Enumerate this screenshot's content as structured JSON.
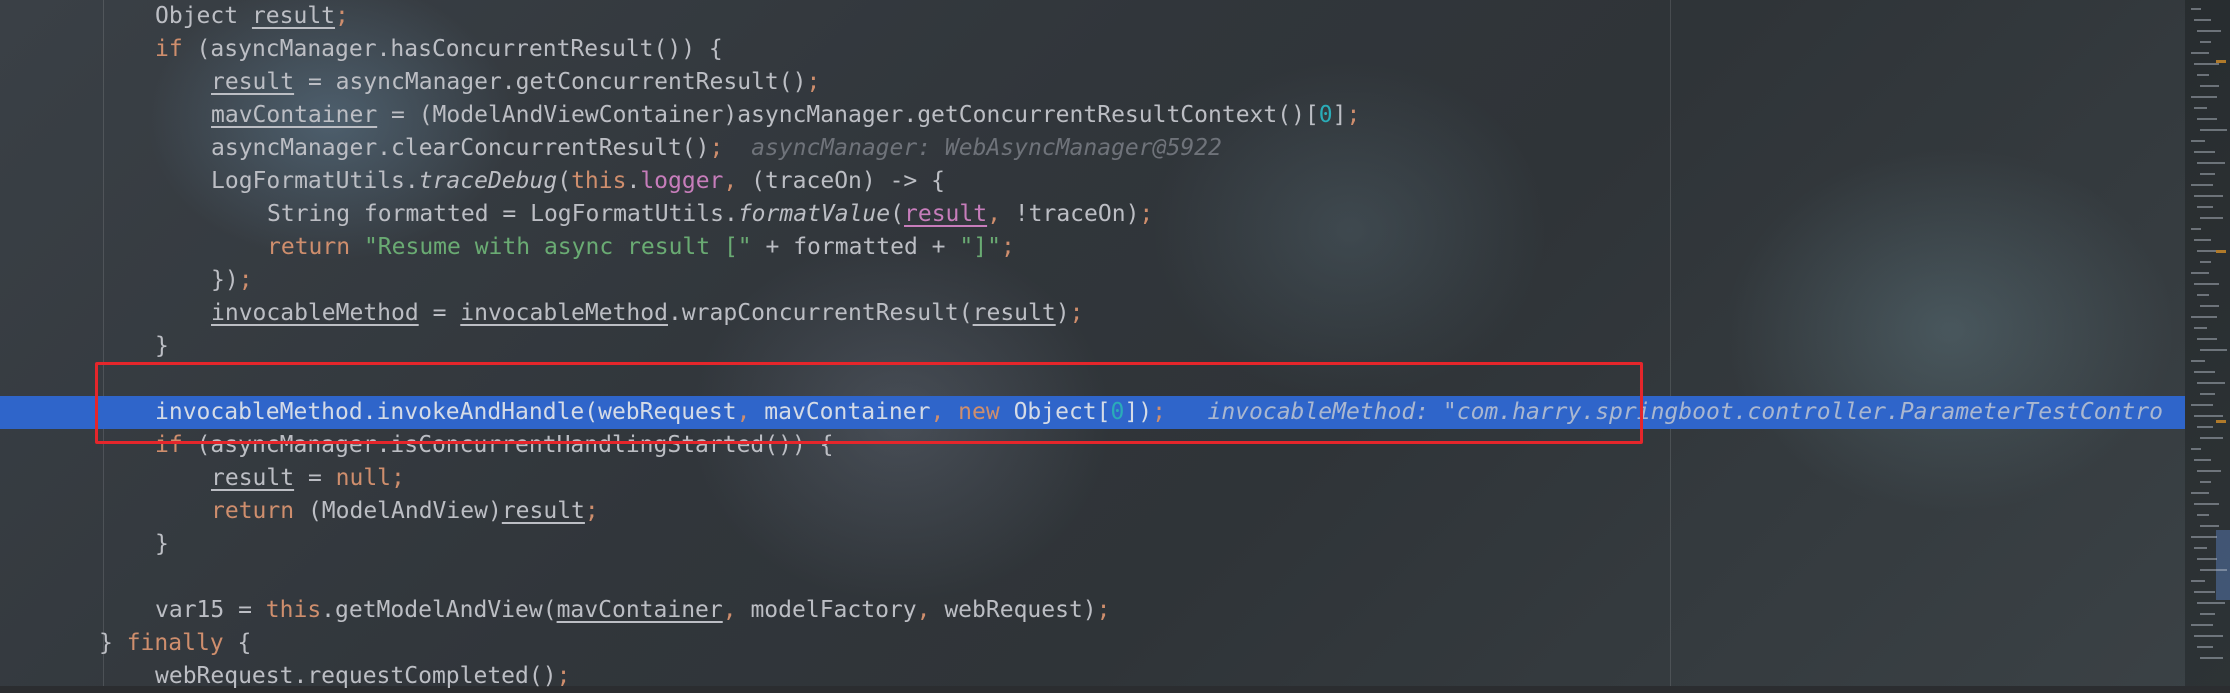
{
  "editor": {
    "lines": [
      {
        "segments": [
          [
            "Object ",
            ""
          ],
          [
            "result",
            "ul"
          ],
          [
            ";",
            "kw"
          ]
        ]
      },
      {
        "segments": [
          [
            "if",
            "kw"
          ],
          [
            " (asyncManager.hasConcurrentResult()) {",
            ""
          ]
        ]
      },
      {
        "segments": [
          [
            "result",
            "ul"
          ],
          [
            " = asyncManager.getConcurrentResult()",
            ""
          ],
          [
            ";",
            "kw"
          ]
        ]
      },
      {
        "segments": [
          [
            "mavContainer",
            "ul"
          ],
          [
            " = (ModelAndViewContainer)asyncManager.getConcurrentResultContext()[",
            ""
          ],
          [
            "0",
            "num"
          ],
          [
            "]",
            ""
          ],
          [
            ";",
            "kw"
          ]
        ]
      },
      {
        "segments": [
          [
            "asyncManager.clearConcurrentResult()",
            ""
          ],
          [
            ";",
            "kw"
          ],
          [
            "  ",
            ""
          ],
          [
            "asyncManager: WebAsyncManager@5922",
            "hint"
          ]
        ]
      },
      {
        "segments": [
          [
            "LogFormatUtils.",
            ""
          ],
          [
            "traceDebug",
            "it"
          ],
          [
            "(",
            ""
          ],
          [
            "this",
            "kw"
          ],
          [
            ".",
            ""
          ],
          [
            "logger",
            "fld"
          ],
          [
            ", ",
            "kw"
          ],
          [
            "(traceOn) -> {",
            ""
          ]
        ]
      },
      {
        "segments": [
          [
            "String formatted = LogFormatUtils.",
            ""
          ],
          [
            "formatValue",
            "it"
          ],
          [
            "(",
            ""
          ],
          [
            "result",
            "fld ul"
          ],
          [
            ", ",
            "kw"
          ],
          [
            "!traceOn)",
            ""
          ],
          [
            ";",
            "kw"
          ]
        ]
      },
      {
        "segments": [
          [
            "return ",
            "kw"
          ],
          [
            "\"Resume with async result [\"",
            "str"
          ],
          [
            " + formatted + ",
            ""
          ],
          [
            "\"]\"",
            "str"
          ],
          [
            ";",
            "kw"
          ]
        ]
      },
      {
        "segments": [
          [
            "})",
            ""
          ],
          [
            ";",
            "kw"
          ]
        ]
      },
      {
        "segments": [
          [
            "invocableMethod",
            "ul"
          ],
          [
            " = ",
            ""
          ],
          [
            "invocableMethod",
            "ul"
          ],
          [
            ".wrapConcurrentResult(",
            ""
          ],
          [
            "result",
            "ul"
          ],
          [
            ")",
            ""
          ],
          [
            ";",
            "kw"
          ]
        ]
      },
      {
        "segments": [
          [
            "}",
            ""
          ]
        ]
      },
      {
        "segments": []
      },
      {
        "segments": [
          [
            "invocableMethod.invokeAndHandle(webRequest",
            ""
          ],
          [
            ", ",
            "kw"
          ],
          [
            "mavContainer",
            ""
          ],
          [
            ", ",
            "kw"
          ],
          [
            "new ",
            "kw"
          ],
          [
            "Object[",
            ""
          ],
          [
            "0",
            "num"
          ],
          [
            "])",
            ""
          ],
          [
            ";",
            "kw"
          ],
          [
            "   ",
            ""
          ],
          [
            "invocableMethod: \"com.harry.springboot.controller.ParameterTestContro",
            "hint"
          ]
        ]
      },
      {
        "segments": [
          [
            "if",
            "kw"
          ],
          [
            " (asyncManager.isConcurrentHandlingStarted()) {",
            ""
          ]
        ]
      },
      {
        "segments": [
          [
            "result",
            "ul"
          ],
          [
            " = ",
            ""
          ],
          [
            "null",
            "kw"
          ],
          [
            ";",
            "kw"
          ]
        ]
      },
      {
        "segments": [
          [
            "return ",
            "kw"
          ],
          [
            "(ModelAndView)",
            ""
          ],
          [
            "result",
            "ul"
          ],
          [
            ";",
            "kw"
          ]
        ]
      },
      {
        "segments": [
          [
            "}",
            ""
          ]
        ]
      },
      {
        "segments": []
      },
      {
        "segments": [
          [
            "var15 = ",
            ""
          ],
          [
            "this",
            "kw"
          ],
          [
            ".getModelAndView(",
            ""
          ],
          [
            "mavContainer",
            "ul"
          ],
          [
            ", ",
            "kw"
          ],
          [
            "modelFactory",
            ""
          ],
          [
            ", ",
            "kw"
          ],
          [
            "webRequest)",
            ""
          ],
          [
            ";",
            "kw"
          ]
        ]
      },
      {
        "segments": [
          [
            "} ",
            ""
          ],
          [
            "finally ",
            "kw"
          ],
          [
            "{",
            ""
          ]
        ]
      },
      {
        "segments": [
          [
            "webRequest.requestCompleted()",
            ""
          ],
          [
            ";",
            "kw"
          ]
        ]
      }
    ]
  },
  "colors": {
    "current_line": "#2f65ca",
    "highlight_box": "#e5262b",
    "keyword": "#cf8e6d",
    "field": "#c77dbb",
    "number": "#2aacb8",
    "string": "#6aab73"
  }
}
